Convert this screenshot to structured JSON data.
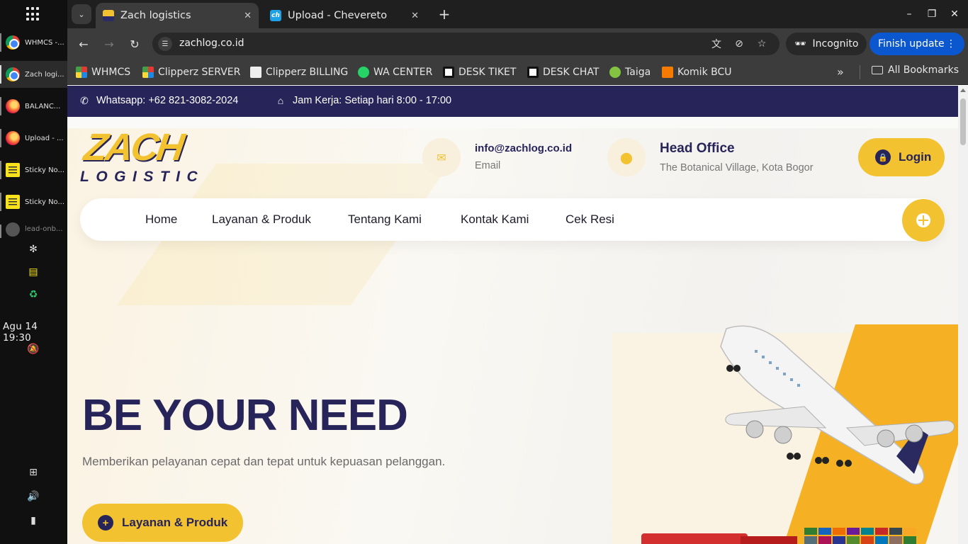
{
  "taskbar": {
    "items": [
      {
        "label": "WHMCS -...",
        "icon": "chrome-icon"
      },
      {
        "label": "Zach logi...",
        "icon": "chrome-icon"
      },
      {
        "label": "BALANC...",
        "icon": "firefox-icon"
      },
      {
        "label": "Upload - ...",
        "icon": "firefox-icon"
      },
      {
        "label": "Sticky No...",
        "icon": "sticky-notes-icon"
      },
      {
        "label": "Sticky No...",
        "icon": "sticky-notes-icon"
      },
      {
        "label": "lead-onb...",
        "icon": "app-icon"
      }
    ],
    "clock": "Agu 14  19:30"
  },
  "browser": {
    "tabs": [
      {
        "title": "Zach logistics",
        "active": true
      },
      {
        "title": "Upload - Chevereto",
        "active": false
      }
    ],
    "url": "zachlog.co.id",
    "incognito_label": "Incognito",
    "update_label": "Finish update",
    "bookmarks": [
      "WHMCS",
      "Clipperz SERVER",
      "Clipperz BILLING",
      "WA CENTER",
      "DESK TIKET",
      "DESK CHAT",
      "Taiga",
      "Komik BCU"
    ],
    "all_bookmarks_label": "All Bookmarks"
  },
  "site": {
    "topbar": {
      "whatsapp": "Whatsapp: +62 821-3082-2024",
      "hours": "Jam Kerja: Setiap hari 8:00 - 17:00"
    },
    "logo": {
      "word1": "ZACH",
      "word2": "LOGISTIC"
    },
    "email": {
      "value": "info@zachlog.co.id",
      "label": "Email"
    },
    "office": {
      "title": "Head Office",
      "address": "The Botanical Village, Kota Bogor"
    },
    "login_label": "Login",
    "nav": [
      "Home",
      "Layanan & Produk",
      "Tentang Kami",
      "Kontak Kami",
      "Cek Resi"
    ],
    "hero": {
      "title": "BE YOUR NEED",
      "subtitle": "Memberikan pelayanan cepat dan tepat untuk kepuasan pelanggan.",
      "cta": "Layanan & Produk"
    },
    "colors": {
      "primary": "#27245a",
      "accent": "#f2c230"
    }
  }
}
